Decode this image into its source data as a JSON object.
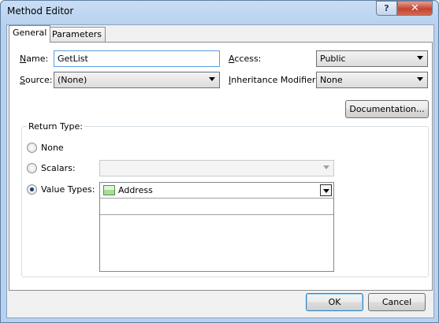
{
  "window": {
    "title": "Method Editor",
    "help_glyph": "?",
    "close_glyph": "✕"
  },
  "tabs": [
    {
      "label": "General",
      "active": true
    },
    {
      "label": "Parameters",
      "active": false
    }
  ],
  "general": {
    "name": {
      "label": "Name:",
      "mnemonic": "N",
      "value": "GetList"
    },
    "access": {
      "label": "Access:",
      "mnemonic": "A",
      "value": "Public"
    },
    "source": {
      "label": "Source:",
      "mnemonic": "S",
      "value": "(None)"
    },
    "inheritance": {
      "label": "Inheritance Modifier:",
      "mnemonic": "I",
      "value": "None"
    },
    "documentation_button": "Documentation..."
  },
  "return_type": {
    "title": "Return Type:",
    "none_label": "None",
    "scalars_label": "Scalars:",
    "scalars_value": "",
    "value_types_label": "Value Types:",
    "selected_option": "Value Types",
    "value_types_items": [
      "Address"
    ],
    "swatch_color": "#a6de94"
  },
  "footer": {
    "ok": "OK",
    "cancel": "Cancel"
  },
  "colors": {
    "titlebar": "#b8d1ee",
    "close_button": "#c2452f",
    "default_button_border": "#3c7fb1"
  }
}
